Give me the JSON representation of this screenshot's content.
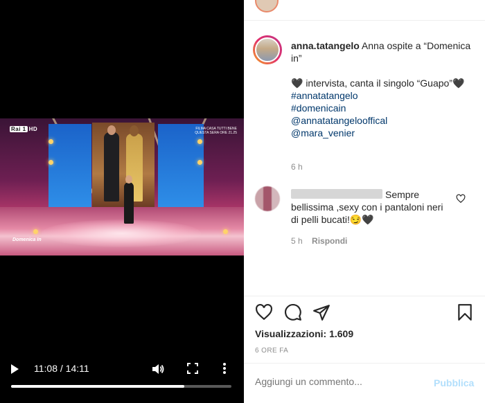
{
  "video": {
    "channel": "Rai 1",
    "channel_mark": "HD",
    "promo_line1": "FILMA CASA TUTTI BENE",
    "promo_line2": "QUESTA SERA ORE 21.25",
    "show_logo": "Domenica In",
    "current_time": "11:08",
    "duration": "14:11",
    "time_display": "11:08 / 14:11",
    "progress": 0.785
  },
  "post": {
    "username": "anna.tatangelo",
    "caption_line1": "Anna ospite a “Domenica in”",
    "caption_line2": "🖤 intervista, canta il singolo “Guapo”🖤",
    "hashtags": [
      "#annatatangelo",
      "#domenicain",
      "@annatatangelooffical",
      "@mara_venier"
    ],
    "time_ago": "6 h"
  },
  "comment": {
    "text": "Sempre bellissima ,sexy con i pantaloni neri di pelli bucati!😏🖤",
    "time_ago": "5 h",
    "reply_label": "Rispondi"
  },
  "actions": {
    "like_icon": "heart-outline-icon",
    "comment_icon": "comment-bubble-icon",
    "share_icon": "paper-plane-icon",
    "save_icon": "bookmark-icon"
  },
  "stats": {
    "views_label": "Visualizzazioni: 1.609",
    "date": "6 ORE FA"
  },
  "compose": {
    "placeholder": "Aggiungi un commento...",
    "publish_label": "Pubblica"
  }
}
